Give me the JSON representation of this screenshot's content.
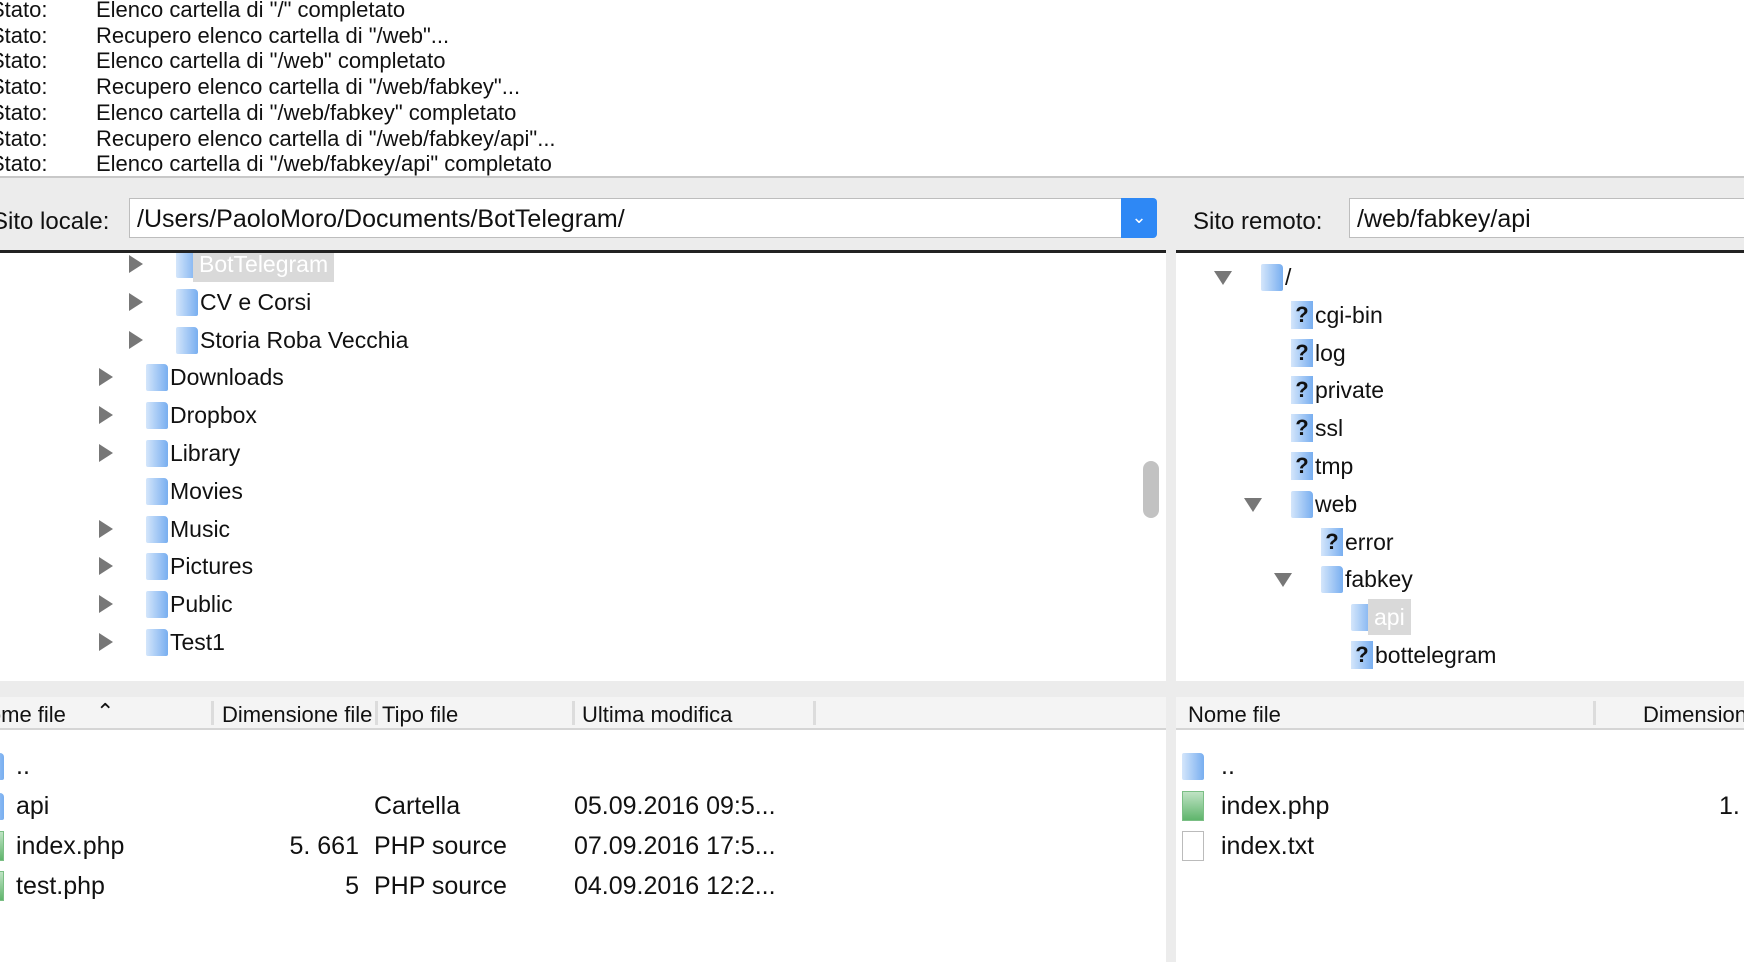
{
  "log": [
    {
      "k": "Stato:",
      "m": "Elenco cartella di \"/\" completato"
    },
    {
      "k": "Stato:",
      "m": "Recupero elenco cartella di \"/web\"..."
    },
    {
      "k": "Stato:",
      "m": "Elenco cartella di \"/web\" completato"
    },
    {
      "k": "Stato:",
      "m": "Recupero elenco cartella di \"/web/fabkey\"..."
    },
    {
      "k": "Stato:",
      "m": "Elenco cartella di \"/web/fabkey\" completato"
    },
    {
      "k": "Stato:",
      "m": "Recupero elenco cartella di \"/web/fabkey/api\"..."
    },
    {
      "k": "Stato:",
      "m": "Elenco cartella di \"/web/fabkey/api\" completato"
    }
  ],
  "local": {
    "label": "Sito locale:",
    "path": "/Users/PaoloMoro/Documents/BotTelegram/",
    "tree": [
      {
        "name": "BotTelegram",
        "level": 1,
        "state": "collapsed",
        "selected": true
      },
      {
        "name": "CV e Corsi",
        "level": 1,
        "state": "collapsed"
      },
      {
        "name": "Storia Roba Vecchia",
        "level": 1,
        "state": "collapsed"
      },
      {
        "name": "Downloads",
        "level": 0,
        "state": "collapsed"
      },
      {
        "name": "Dropbox",
        "level": 0,
        "state": "collapsed"
      },
      {
        "name": "Library",
        "level": 0,
        "state": "collapsed"
      },
      {
        "name": "Movies",
        "level": 0,
        "state": "none"
      },
      {
        "name": "Music",
        "level": 0,
        "state": "collapsed"
      },
      {
        "name": "Pictures",
        "level": 0,
        "state": "collapsed"
      },
      {
        "name": "Public",
        "level": 0,
        "state": "collapsed"
      },
      {
        "name": "Test1",
        "level": 0,
        "state": "collapsed"
      }
    ],
    "columns": [
      "Nome file",
      "Dimensione file",
      "Tipo file",
      "Ultima modifica"
    ],
    "sort_icon": "chevron-up-icon",
    "files": [
      {
        "name": "..",
        "size": "",
        "type": "",
        "modified": "",
        "icon": "folder"
      },
      {
        "name": "api",
        "size": "",
        "type": "Cartella",
        "modified": "05.09.2016 09:5...",
        "icon": "folder"
      },
      {
        "name": "index.php",
        "size": "5. 661",
        "type": "PHP source",
        "modified": "07.09.2016 17:5...",
        "icon": "php"
      },
      {
        "name": "test.php",
        "size": "5",
        "type": "PHP source",
        "modified": "04.09.2016 12:2...",
        "icon": "php"
      }
    ]
  },
  "remote": {
    "label": "Sito remoto:",
    "path": "/web/fabkey/api",
    "tree": [
      {
        "name": "/",
        "level": 0,
        "state": "expanded",
        "icon": "folder"
      },
      {
        "name": "cgi-bin",
        "level": 1,
        "state": "none",
        "icon": "unknown"
      },
      {
        "name": "log",
        "level": 1,
        "state": "none",
        "icon": "unknown"
      },
      {
        "name": "private",
        "level": 1,
        "state": "none",
        "icon": "unknown"
      },
      {
        "name": "ssl",
        "level": 1,
        "state": "none",
        "icon": "unknown"
      },
      {
        "name": "tmp",
        "level": 1,
        "state": "none",
        "icon": "unknown"
      },
      {
        "name": "web",
        "level": 1,
        "state": "expanded",
        "icon": "folder"
      },
      {
        "name": "error",
        "level": 2,
        "state": "none",
        "icon": "unknown"
      },
      {
        "name": "fabkey",
        "level": 2,
        "state": "expanded",
        "icon": "folder"
      },
      {
        "name": "api",
        "level": 3,
        "state": "none",
        "icon": "folder",
        "selected": true
      },
      {
        "name": "bottelegram",
        "level": 3,
        "state": "none",
        "icon": "unknown"
      }
    ],
    "columns": [
      "Nome file",
      "Dimensione file"
    ],
    "files": [
      {
        "name": "..",
        "size": "",
        "icon": "folder"
      },
      {
        "name": "index.php",
        "size": "1.",
        "icon": "php"
      },
      {
        "name": "index.txt",
        "size": "",
        "icon": "text"
      }
    ]
  }
}
